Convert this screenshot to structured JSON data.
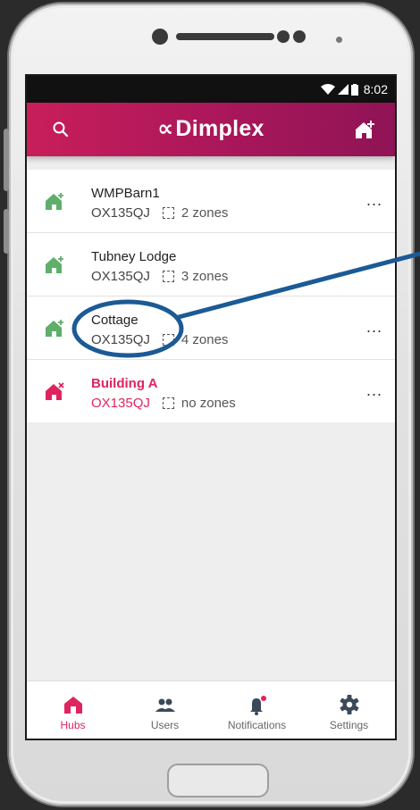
{
  "status_bar": {
    "time": "8:02"
  },
  "app_bar": {
    "brand": "Dimplex",
    "brand_mark": "∝"
  },
  "hubs": [
    {
      "name": "WMPBarn1",
      "postcode": "OX135QJ",
      "zones": "2 zones",
      "state": "ok"
    },
    {
      "name": "Tubney Lodge",
      "postcode": "OX135QJ",
      "zones": "3 zones",
      "state": "ok"
    },
    {
      "name": "Cottage",
      "postcode": "OX135QJ",
      "zones": "4 zones",
      "state": "ok",
      "highlighted": true
    },
    {
      "name": "Building A",
      "postcode": "OX135QJ",
      "zones": "no zones",
      "state": "error"
    }
  ],
  "more_label": "...",
  "bottom_nav": [
    {
      "label": "Hubs",
      "icon": "home-icon",
      "active": true
    },
    {
      "label": "Users",
      "icon": "users-icon"
    },
    {
      "label": "Notifications",
      "icon": "bell-icon",
      "badge": true
    },
    {
      "label": "Settings",
      "icon": "gear-icon"
    }
  ],
  "colors": {
    "brand": "#c81e5a",
    "accent_red": "#e0245e",
    "hub_ok": "#5fae6a",
    "annotation": "#1b5a96"
  }
}
